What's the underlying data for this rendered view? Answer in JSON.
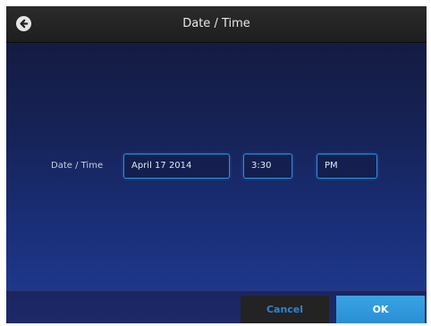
{
  "header": {
    "title": "Date / Time",
    "back_icon": "back-arrow-circle-icon"
  },
  "form": {
    "label": "Date / Time",
    "date_value": "April 17 2014",
    "time_value": "3:30",
    "ampm_value": "PM"
  },
  "footer": {
    "cancel_label": "Cancel",
    "ok_label": "OK"
  },
  "colors": {
    "accent": "#2a8ee0",
    "ok_button": "#3aa3e4",
    "title_bar": "#222222"
  }
}
